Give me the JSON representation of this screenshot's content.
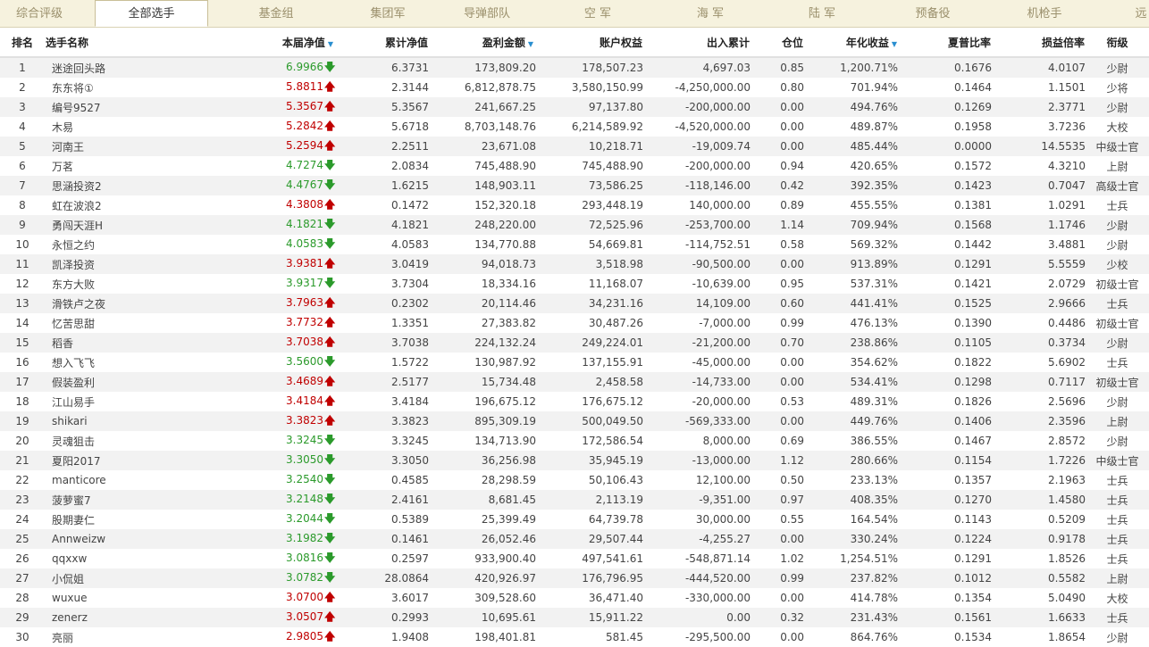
{
  "tabs": [
    "综合评级",
    "全部选手",
    "基金组",
    "集团军",
    "导弹部队",
    "空 军",
    "海 军",
    "陆 军",
    "预备役",
    "机枪手",
    "远"
  ],
  "active_tab": 1,
  "headers": {
    "rank": "排名",
    "name": "选手名称",
    "nav": "本届净值",
    "cum_nav": "累计净值",
    "profit": "盈利金额",
    "equity": "账户权益",
    "inout": "出入累计",
    "position": "仓位",
    "annual": "年化收益",
    "sharpe": "夏普比率",
    "pl_ratio": "损益倍率",
    "rank_title": "衔级"
  },
  "sort_marker": "▼",
  "up_arrow": "🡅",
  "down_arrow": "🡇",
  "rows": [
    {
      "rank": "1",
      "name": "迷途回头路",
      "nav": "6.9966",
      "dir": "down",
      "cum_nav": "6.3731",
      "profit": "173,809.20",
      "equity": "178,507.23",
      "inout": "4,697.03",
      "position": "0.85",
      "annual": "1,200.71%",
      "sharpe": "0.1676",
      "pl_ratio": "4.0107",
      "rank_title": "少尉"
    },
    {
      "rank": "2",
      "name": "东东将①",
      "nav": "5.8811",
      "dir": "up",
      "cum_nav": "2.3144",
      "profit": "6,812,878.75",
      "equity": "3,580,150.99",
      "inout": "-4,250,000.00",
      "position": "0.80",
      "annual": "701.94%",
      "sharpe": "0.1464",
      "pl_ratio": "1.1501",
      "rank_title": "少将"
    },
    {
      "rank": "3",
      "name": "编号9527",
      "nav": "5.3567",
      "dir": "up",
      "cum_nav": "5.3567",
      "profit": "241,667.25",
      "equity": "97,137.80",
      "inout": "-200,000.00",
      "position": "0.00",
      "annual": "494.76%",
      "sharpe": "0.1269",
      "pl_ratio": "2.3771",
      "rank_title": "少尉"
    },
    {
      "rank": "4",
      "name": "木易",
      "nav": "5.2842",
      "dir": "up",
      "cum_nav": "5.6718",
      "profit": "8,703,148.76",
      "equity": "6,214,589.92",
      "inout": "-4,520,000.00",
      "position": "0.00",
      "annual": "489.87%",
      "sharpe": "0.1958",
      "pl_ratio": "3.7236",
      "rank_title": "大校"
    },
    {
      "rank": "5",
      "name": "河南王",
      "nav": "5.2594",
      "dir": "up",
      "cum_nav": "2.2511",
      "profit": "23,671.08",
      "equity": "10,218.71",
      "inout": "-19,009.74",
      "position": "0.00",
      "annual": "485.44%",
      "sharpe": "0.0000",
      "pl_ratio": "14.5535",
      "rank_title": "中级士官"
    },
    {
      "rank": "6",
      "name": "万茗",
      "nav": "4.7274",
      "dir": "down",
      "cum_nav": "2.0834",
      "profit": "745,488.90",
      "equity": "745,488.90",
      "inout": "-200,000.00",
      "position": "0.94",
      "annual": "420.65%",
      "sharpe": "0.1572",
      "pl_ratio": "4.3210",
      "rank_title": "上尉"
    },
    {
      "rank": "7",
      "name": "思涵投资2",
      "nav": "4.4767",
      "dir": "down",
      "cum_nav": "1.6215",
      "profit": "148,903.11",
      "equity": "73,586.25",
      "inout": "-118,146.00",
      "position": "0.42",
      "annual": "392.35%",
      "sharpe": "0.1423",
      "pl_ratio": "0.7047",
      "rank_title": "高级士官"
    },
    {
      "rank": "8",
      "name": "虹在波浪2",
      "nav": "4.3808",
      "dir": "up",
      "cum_nav": "0.1472",
      "profit": "152,320.18",
      "equity": "293,448.19",
      "inout": "140,000.00",
      "position": "0.89",
      "annual": "455.55%",
      "sharpe": "0.1381",
      "pl_ratio": "1.0291",
      "rank_title": "士兵"
    },
    {
      "rank": "9",
      "name": "勇闯天涯H",
      "nav": "4.1821",
      "dir": "down",
      "cum_nav": "4.1821",
      "profit": "248,220.00",
      "equity": "72,525.96",
      "inout": "-253,700.00",
      "position": "1.14",
      "annual": "709.94%",
      "sharpe": "0.1568",
      "pl_ratio": "1.1746",
      "rank_title": "少尉"
    },
    {
      "rank": "10",
      "name": "永恒之约",
      "nav": "4.0583",
      "dir": "down",
      "cum_nav": "4.0583",
      "profit": "134,770.88",
      "equity": "54,669.81",
      "inout": "-114,752.51",
      "position": "0.58",
      "annual": "569.32%",
      "sharpe": "0.1442",
      "pl_ratio": "3.4881",
      "rank_title": "少尉"
    },
    {
      "rank": "11",
      "name": "凯泽投资",
      "nav": "3.9381",
      "dir": "up",
      "cum_nav": "3.0419",
      "profit": "94,018.73",
      "equity": "3,518.98",
      "inout": "-90,500.00",
      "position": "0.00",
      "annual": "913.89%",
      "sharpe": "0.1291",
      "pl_ratio": "5.5559",
      "rank_title": "少校"
    },
    {
      "rank": "12",
      "name": "东方大败",
      "nav": "3.9317",
      "dir": "down",
      "cum_nav": "3.7304",
      "profit": "18,334.16",
      "equity": "11,168.07",
      "inout": "-10,639.00",
      "position": "0.95",
      "annual": "537.31%",
      "sharpe": "0.1421",
      "pl_ratio": "2.0729",
      "rank_title": "初级士官"
    },
    {
      "rank": "13",
      "name": "滑铁卢之夜",
      "nav": "3.7963",
      "dir": "up",
      "cum_nav": "0.2302",
      "profit": "20,114.46",
      "equity": "34,231.16",
      "inout": "14,109.00",
      "position": "0.60",
      "annual": "441.41%",
      "sharpe": "0.1525",
      "pl_ratio": "2.9666",
      "rank_title": "士兵"
    },
    {
      "rank": "14",
      "name": "忆苦思甜",
      "nav": "3.7732",
      "dir": "up",
      "cum_nav": "1.3351",
      "profit": "27,383.82",
      "equity": "30,487.26",
      "inout": "-7,000.00",
      "position": "0.99",
      "annual": "476.13%",
      "sharpe": "0.1390",
      "pl_ratio": "0.4486",
      "rank_title": "初级士官"
    },
    {
      "rank": "15",
      "name": "稻香",
      "nav": "3.7038",
      "dir": "up",
      "cum_nav": "3.7038",
      "profit": "224,132.24",
      "equity": "249,224.01",
      "inout": "-21,200.00",
      "position": "0.70",
      "annual": "238.86%",
      "sharpe": "0.1105",
      "pl_ratio": "0.3734",
      "rank_title": "少尉"
    },
    {
      "rank": "16",
      "name": "想入飞飞",
      "nav": "3.5600",
      "dir": "down",
      "cum_nav": "1.5722",
      "profit": "130,987.92",
      "equity": "137,155.91",
      "inout": "-45,000.00",
      "position": "0.00",
      "annual": "354.62%",
      "sharpe": "0.1822",
      "pl_ratio": "5.6902",
      "rank_title": "士兵"
    },
    {
      "rank": "17",
      "name": "假装盈利",
      "nav": "3.4689",
      "dir": "up",
      "cum_nav": "2.5177",
      "profit": "15,734.48",
      "equity": "2,458.58",
      "inout": "-14,733.00",
      "position": "0.00",
      "annual": "534.41%",
      "sharpe": "0.1298",
      "pl_ratio": "0.7117",
      "rank_title": "初级士官"
    },
    {
      "rank": "18",
      "name": "江山易手",
      "nav": "3.4184",
      "dir": "up",
      "cum_nav": "3.4184",
      "profit": "196,675.12",
      "equity": "176,675.12",
      "inout": "-20,000.00",
      "position": "0.53",
      "annual": "489.31%",
      "sharpe": "0.1826",
      "pl_ratio": "2.5696",
      "rank_title": "少尉"
    },
    {
      "rank": "19",
      "name": "shikari",
      "nav": "3.3823",
      "dir": "up",
      "cum_nav": "3.3823",
      "profit": "895,309.19",
      "equity": "500,049.50",
      "inout": "-569,333.00",
      "position": "0.00",
      "annual": "449.76%",
      "sharpe": "0.1406",
      "pl_ratio": "2.3596",
      "rank_title": "上尉"
    },
    {
      "rank": "20",
      "name": "灵魂狙击",
      "nav": "3.3245",
      "dir": "down",
      "cum_nav": "3.3245",
      "profit": "134,713.90",
      "equity": "172,586.54",
      "inout": "8,000.00",
      "position": "0.69",
      "annual": "386.55%",
      "sharpe": "0.1467",
      "pl_ratio": "2.8572",
      "rank_title": "少尉"
    },
    {
      "rank": "21",
      "name": "夏阳2017",
      "nav": "3.3050",
      "dir": "down",
      "cum_nav": "3.3050",
      "profit": "36,256.98",
      "equity": "35,945.19",
      "inout": "-13,000.00",
      "position": "1.12",
      "annual": "280.66%",
      "sharpe": "0.1154",
      "pl_ratio": "1.7226",
      "rank_title": "中级士官"
    },
    {
      "rank": "22",
      "name": "manticore",
      "nav": "3.2540",
      "dir": "down",
      "cum_nav": "0.4585",
      "profit": "28,298.59",
      "equity": "50,106.43",
      "inout": "12,100.00",
      "position": "0.50",
      "annual": "233.13%",
      "sharpe": "0.1357",
      "pl_ratio": "2.1963",
      "rank_title": "士兵"
    },
    {
      "rank": "23",
      "name": "菠萝蜜7",
      "nav": "3.2148",
      "dir": "down",
      "cum_nav": "2.4161",
      "profit": "8,681.45",
      "equity": "2,113.19",
      "inout": "-9,351.00",
      "position": "0.97",
      "annual": "408.35%",
      "sharpe": "0.1270",
      "pl_ratio": "1.4580",
      "rank_title": "士兵"
    },
    {
      "rank": "24",
      "name": "股期妻仁",
      "nav": "3.2044",
      "dir": "down",
      "cum_nav": "0.5389",
      "profit": "25,399.49",
      "equity": "64,739.78",
      "inout": "30,000.00",
      "position": "0.55",
      "annual": "164.54%",
      "sharpe": "0.1143",
      "pl_ratio": "0.5209",
      "rank_title": "士兵"
    },
    {
      "rank": "25",
      "name": "Annweizw",
      "nav": "3.1982",
      "dir": "down",
      "cum_nav": "0.1461",
      "profit": "26,052.46",
      "equity": "29,507.44",
      "inout": "-4,255.27",
      "position": "0.00",
      "annual": "330.24%",
      "sharpe": "0.1224",
      "pl_ratio": "0.9178",
      "rank_title": "士兵"
    },
    {
      "rank": "26",
      "name": "qqxxw",
      "nav": "3.0816",
      "dir": "down",
      "cum_nav": "0.2597",
      "profit": "933,900.40",
      "equity": "497,541.61",
      "inout": "-548,871.14",
      "position": "1.02",
      "annual": "1,254.51%",
      "sharpe": "0.1291",
      "pl_ratio": "1.8526",
      "rank_title": "士兵"
    },
    {
      "rank": "27",
      "name": "小侃姐",
      "nav": "3.0782",
      "dir": "down",
      "cum_nav": "28.0864",
      "profit": "420,926.97",
      "equity": "176,796.95",
      "inout": "-444,520.00",
      "position": "0.99",
      "annual": "237.82%",
      "sharpe": "0.1012",
      "pl_ratio": "0.5582",
      "rank_title": "上尉"
    },
    {
      "rank": "28",
      "name": "wuxue",
      "nav": "3.0700",
      "dir": "up",
      "cum_nav": "3.6017",
      "profit": "309,528.60",
      "equity": "36,471.40",
      "inout": "-330,000.00",
      "position": "0.00",
      "annual": "414.78%",
      "sharpe": "0.1354",
      "pl_ratio": "5.0490",
      "rank_title": "大校"
    },
    {
      "rank": "29",
      "name": "zenerz",
      "nav": "3.0507",
      "dir": "up",
      "cum_nav": "0.2993",
      "profit": "10,695.61",
      "equity": "15,911.22",
      "inout": "0.00",
      "position": "0.32",
      "annual": "231.43%",
      "sharpe": "0.1561",
      "pl_ratio": "1.6633",
      "rank_title": "士兵"
    },
    {
      "rank": "30",
      "name": "亮丽",
      "nav": "2.9805",
      "dir": "up",
      "cum_nav": "1.9408",
      "profit": "198,401.81",
      "equity": "581.45",
      "inout": "-295,500.00",
      "position": "0.00",
      "annual": "864.76%",
      "sharpe": "0.1534",
      "pl_ratio": "1.8654",
      "rank_title": "少尉"
    }
  ],
  "colors": {
    "up": "#c00000",
    "down": "#2b9a2b",
    "sort": "#2a8fd0",
    "tabbar": "#f6f2de"
  }
}
